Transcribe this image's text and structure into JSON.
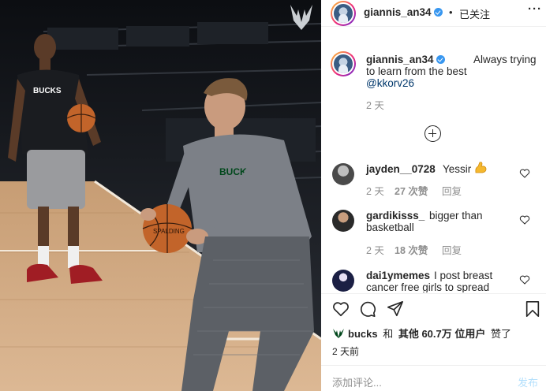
{
  "post": {
    "account": "giannis_an34",
    "follow_dot": "•",
    "follow_state": "已关注",
    "more_icon": "more-horizontal-icon",
    "caption": {
      "user": "giannis_an34",
      "text_part1": "Always trying",
      "text_part2": "to learn from the best",
      "mention": "@kkorv26",
      "time": "2 天"
    },
    "load_more_icon": "plus-circle-icon",
    "comments": [
      {
        "user": "jayden__0728",
        "text": "Yessir",
        "emoji": "flexed-biceps-icon",
        "time": "2 天",
        "likes": "27 次赞",
        "reply": "回复"
      },
      {
        "user": "gardikisss_",
        "text_part1": "bigger than",
        "text_part2": "basketball",
        "time": "2 天",
        "likes": "18 次赞",
        "reply": "回复"
      },
      {
        "user": "dai1ymemes",
        "text_part1": "I post breast",
        "text_part2": "cancer free girls to spread"
      }
    ],
    "likes": {
      "user": "bucks",
      "conj": "和",
      "others": "其他 60.7万 位用户",
      "suffix": "赞了"
    },
    "time_ago": "2 天前",
    "comment_placeholder": "添加评论...",
    "post_button": "发布"
  },
  "colors": {
    "link": "#00376b",
    "muted": "#8e8e8e",
    "verified": "#3897f0",
    "post_disabled": "#b2dffc",
    "bucks_green": "#00471b"
  }
}
